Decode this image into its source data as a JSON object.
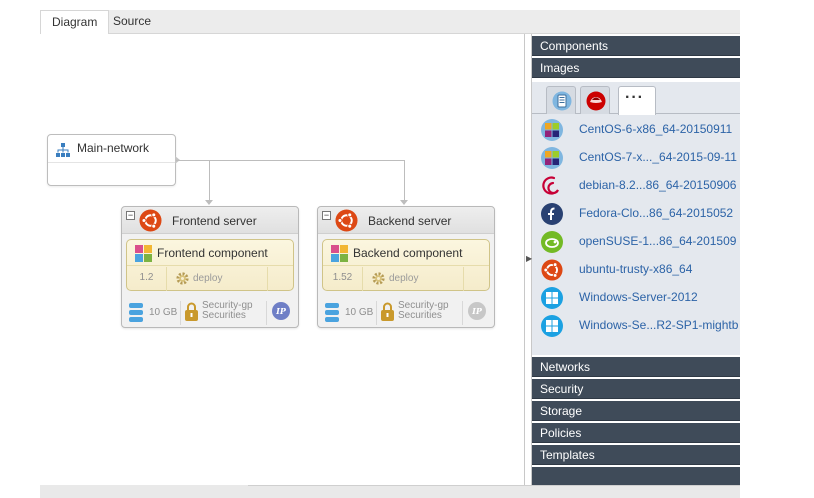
{
  "tabs": [
    {
      "label": "Diagram",
      "active": true
    },
    {
      "label": "Source",
      "active": false
    }
  ],
  "network": {
    "label": "Main-network",
    "icon": "network-tree-icon"
  },
  "servers": [
    {
      "title": "Frontend server",
      "os_icon": "ubuntu-icon",
      "component": {
        "title": "Frontend component",
        "version": "1.2",
        "action": "deploy"
      },
      "storage": "10 GB",
      "security_group": [
        "Security-gp",
        "Securities"
      ],
      "ip_active": true
    },
    {
      "title": "Backend server",
      "os_icon": "ubuntu-icon",
      "component": {
        "title": "Backend component",
        "version": "1.52",
        "action": "deploy"
      },
      "storage": "10 GB",
      "security_group": [
        "Security-gp",
        "Securities"
      ],
      "ip_active": false
    }
  ],
  "panel": {
    "sections_top": [
      "Components",
      "Images"
    ],
    "image_tabs": [
      "document-icon",
      "redhat-icon",
      "more-icon"
    ],
    "images": [
      {
        "label": "CentOS-6-x86_64-20150911",
        "icon": "centos-icon"
      },
      {
        "label": "CentOS-7-x..._64-2015-09-11",
        "icon": "centos-icon"
      },
      {
        "label": "debian-8.2...86_64-20150906",
        "icon": "debian-icon"
      },
      {
        "label": "Fedora-Clo...86_64-2015052",
        "icon": "fedora-icon"
      },
      {
        "label": "openSUSE-1...86_64-201509",
        "icon": "opensuse-icon"
      },
      {
        "label": "ubuntu-trusty-x86_64",
        "icon": "ubuntu-icon"
      },
      {
        "label": "Windows-Server-2012",
        "icon": "windows-icon"
      },
      {
        "label": "Windows-Se...R2-SP1-mightb",
        "icon": "windows-icon"
      }
    ],
    "sections_bottom": [
      "Networks",
      "Security",
      "Storage",
      "Policies",
      "Templates"
    ]
  },
  "colors": {
    "panel_header": "#3f4b59",
    "image_link": "#2c63a7",
    "ubuntu": "#dd4814",
    "component_bg": "#f7efd1",
    "ip_active": "#6f7fc6",
    "ip_inactive": "#c7c7c7",
    "lock": "#c9992c",
    "storage": "#4aa3df"
  }
}
